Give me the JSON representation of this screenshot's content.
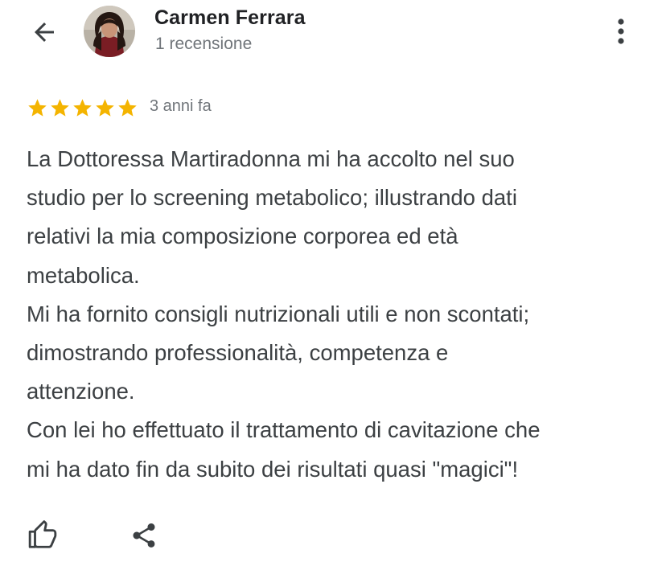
{
  "header": {
    "back_icon": "arrow-left-icon",
    "reviewer_name": "Carmen Ferrara",
    "review_count": "1 recensione",
    "more_icon": "more-vertical-icon"
  },
  "review": {
    "rating": 5,
    "max_rating": 5,
    "star_color": "#f4b400",
    "time_ago": "3 anni fa",
    "text_lines": [
      "La Dottoressa Martiradonna mi ha accolto nel suo",
      "studio per lo screening metabolico; illustrando dati",
      "relativi la mia composizione corporea ed età",
      "metabolica.",
      "Mi ha fornito consigli nutrizionali utili e non scontati;",
      "dimostrando professionalità, competenza e",
      "attenzione.",
      "Con lei ho effettuato il trattamento di cavitazione che",
      "mi ha dato fin da subito dei risultati quasi \"magici\"!"
    ]
  },
  "actions": {
    "like_icon": "thumb-up-icon",
    "share_icon": "share-icon"
  }
}
